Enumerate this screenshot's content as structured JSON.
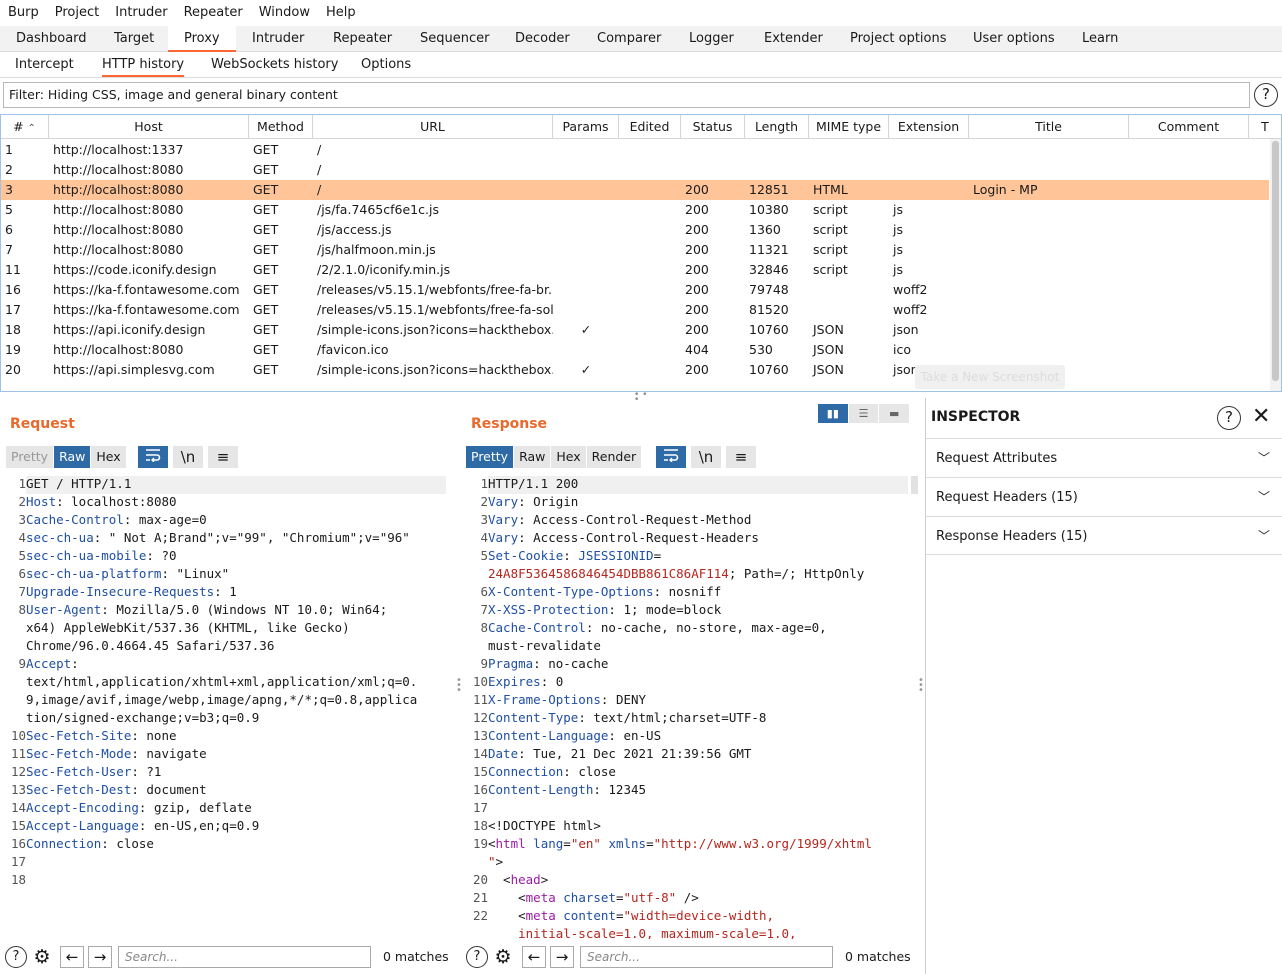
{
  "menu": [
    "Burp",
    "Project",
    "Intruder",
    "Repeater",
    "Window",
    "Help"
  ],
  "main_tabs": [
    "Dashboard",
    "Target",
    "Proxy",
    "Intruder",
    "Repeater",
    "Sequencer",
    "Decoder",
    "Comparer",
    "Logger",
    "Extender",
    "Project options",
    "User options",
    "Learn"
  ],
  "sub_tabs": [
    "Intercept",
    "HTTP history",
    "WebSockets history",
    "Options"
  ],
  "filter": {
    "text": "Filter: Hiding CSS, image and general binary content",
    "help": "?"
  },
  "table": {
    "columns": [
      "#",
      "Host",
      "Method",
      "URL",
      "Params",
      "Edited",
      "Status",
      "Length",
      "MIME type",
      "Extension",
      "Title",
      "Comment",
      "T"
    ],
    "sort_indicator": "^",
    "rows": [
      {
        "num": "1",
        "host": "http://localhost:1337",
        "method": "GET",
        "url": "/",
        "params": "",
        "edited": "",
        "status": "",
        "length": "",
        "mime": "",
        "ext": "",
        "title": "",
        "comment": ""
      },
      {
        "num": "2",
        "host": "http://localhost:8080",
        "method": "GET",
        "url": "/",
        "params": "",
        "edited": "",
        "status": "",
        "length": "",
        "mime": "",
        "ext": "",
        "title": "",
        "comment": ""
      },
      {
        "num": "3",
        "host": "http://localhost:8080",
        "method": "GET",
        "url": "/",
        "params": "",
        "edited": "",
        "status": "200",
        "length": "12851",
        "mime": "HTML",
        "ext": "",
        "title": "Login - MP",
        "comment": ""
      },
      {
        "num": "5",
        "host": "http://localhost:8080",
        "method": "GET",
        "url": "/js/fa.7465cf6e1c.js",
        "params": "",
        "edited": "",
        "status": "200",
        "length": "10380",
        "mime": "script",
        "ext": "js",
        "title": "",
        "comment": ""
      },
      {
        "num": "6",
        "host": "http://localhost:8080",
        "method": "GET",
        "url": "/js/access.js",
        "params": "",
        "edited": "",
        "status": "200",
        "length": "1360",
        "mime": "script",
        "ext": "js",
        "title": "",
        "comment": ""
      },
      {
        "num": "7",
        "host": "http://localhost:8080",
        "method": "GET",
        "url": "/js/halfmoon.min.js",
        "params": "",
        "edited": "",
        "status": "200",
        "length": "11321",
        "mime": "script",
        "ext": "js",
        "title": "",
        "comment": ""
      },
      {
        "num": "11",
        "host": "https://code.iconify.design",
        "method": "GET",
        "url": "/2/2.1.0/iconify.min.js",
        "params": "",
        "edited": "",
        "status": "200",
        "length": "32846",
        "mime": "script",
        "ext": "js",
        "title": "",
        "comment": ""
      },
      {
        "num": "16",
        "host": "https://ka-f.fontawesome.com",
        "method": "GET",
        "url": "/releases/v5.15.1/webfonts/free-fa-br...",
        "params": "",
        "edited": "",
        "status": "200",
        "length": "79748",
        "mime": "",
        "ext": "woff2",
        "title": "",
        "comment": ""
      },
      {
        "num": "17",
        "host": "https://ka-f.fontawesome.com",
        "method": "GET",
        "url": "/releases/v5.15.1/webfonts/free-fa-sol...",
        "params": "",
        "edited": "",
        "status": "200",
        "length": "81520",
        "mime": "",
        "ext": "woff2",
        "title": "",
        "comment": ""
      },
      {
        "num": "18",
        "host": "https://api.iconify.design",
        "method": "GET",
        "url": "/simple-icons.json?icons=hackthebox...",
        "params": "✓",
        "edited": "",
        "status": "200",
        "length": "10760",
        "mime": "JSON",
        "ext": "json",
        "title": "",
        "comment": ""
      },
      {
        "num": "19",
        "host": "http://localhost:8080",
        "method": "GET",
        "url": "/favicon.ico",
        "params": "",
        "edited": "",
        "status": "404",
        "length": "530",
        "mime": "JSON",
        "ext": "ico",
        "title": "",
        "comment": ""
      },
      {
        "num": "20",
        "host": "https://api.simplesvg.com",
        "method": "GET",
        "url": "/simple-icons.json?icons=hackthebox...",
        "params": "✓",
        "edited": "",
        "status": "200",
        "length": "10760",
        "mime": "JSON",
        "ext": "json",
        "title": "",
        "comment": ""
      }
    ],
    "selected_row": "3"
  },
  "tooltip": "Take a New Screenshot",
  "request": {
    "title": "Request",
    "view_buttons": [
      "Pretty",
      "Raw",
      "Hex"
    ],
    "active_view": "Raw",
    "icons": [
      "wrap-icon",
      "newline-icon",
      "menu-icon"
    ],
    "newline_label": "\\n"
  },
  "response": {
    "title": "Response",
    "view_buttons": [
      "Pretty",
      "Raw",
      "Hex",
      "Render"
    ],
    "active_view": "Pretty",
    "newline_label": "\\n"
  },
  "bottom": {
    "search_placeholder": "Search...",
    "req_matches": "0 matches",
    "res_matches": "0 matches"
  },
  "inspector": {
    "title": "INSPECTOR",
    "help": "?",
    "sections": [
      "Request Attributes",
      "Request Headers (15)",
      "Response Headers (15)"
    ]
  },
  "colors": {
    "accent": "#ff6633",
    "selected_row": "#ffc599",
    "active_button": "#2d6aa6",
    "title": "#e8692b"
  }
}
